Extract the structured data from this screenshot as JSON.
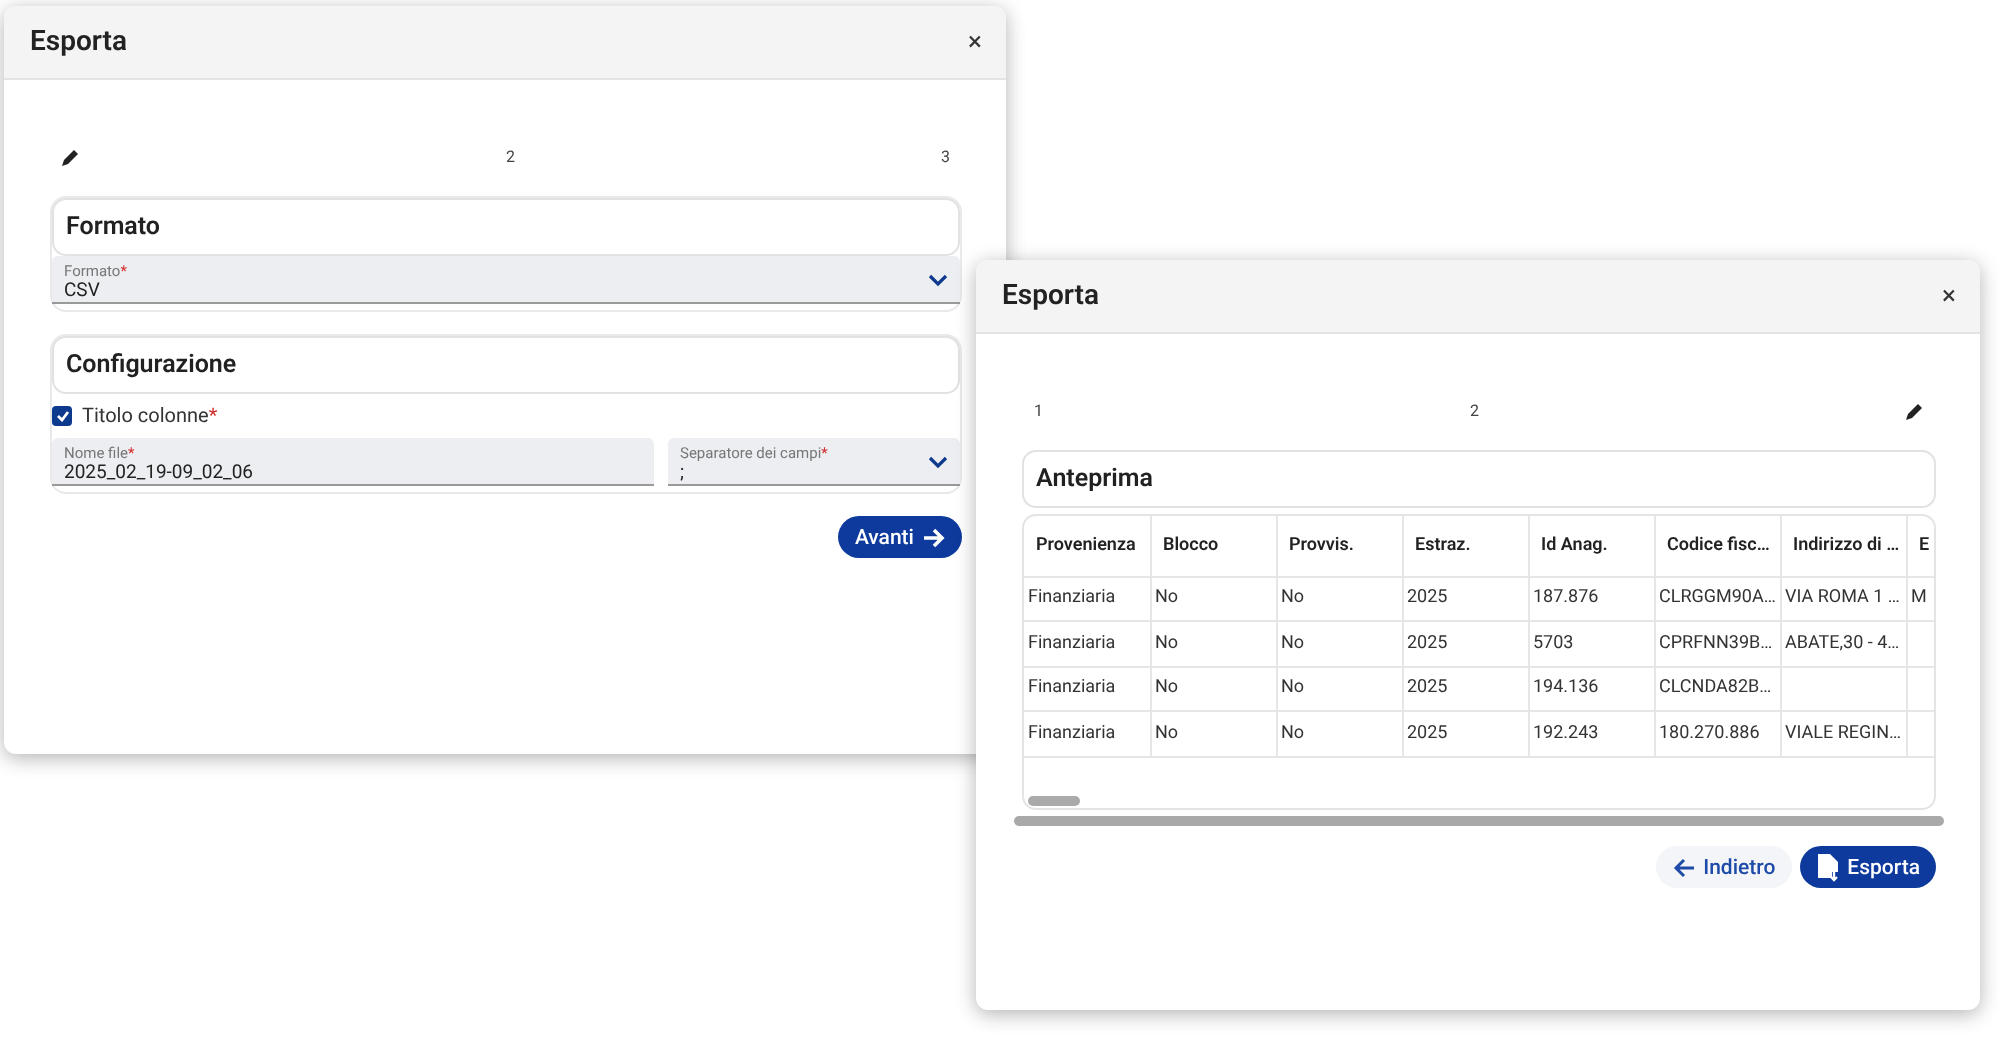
{
  "dialogs": [
    {
      "title": "Esporta",
      "close": "×",
      "steps": [
        {
          "kind": "edit"
        },
        {
          "kind": "number",
          "label": "2"
        },
        {
          "kind": "number",
          "label": "3"
        }
      ],
      "sections": [
        {
          "title": "Formato",
          "fields": [
            {
              "kind": "select",
              "label": "Formato",
              "required_mark": "*",
              "value": "CSV"
            }
          ]
        },
        {
          "title": "Configurazione",
          "checkbox": {
            "label": "Titolo colonne",
            "checked": true,
            "required_mark": "*"
          },
          "fields": [
            {
              "kind": "text",
              "label": "Nome file",
              "required_mark": "*",
              "value": "2025_02_19-09_02_06"
            },
            {
              "kind": "select",
              "label": "Separatore dei campi",
              "required_mark": "*",
              "value": ";"
            }
          ]
        }
      ],
      "buttons": [
        {
          "kind": "next",
          "label": "Avanti"
        }
      ]
    },
    {
      "title": "Esporta",
      "close": "×",
      "steps": [
        {
          "kind": "number",
          "label": "1"
        },
        {
          "kind": "number",
          "label": "2"
        },
        {
          "kind": "edit"
        }
      ],
      "preview": {
        "title": "Anteprima",
        "table": {
          "columns": [
            "Provenienza",
            "Blocco",
            "Provvis.",
            "Estraz.",
            "Id Anag.",
            "Codice fisc…",
            "Indirizzo di …",
            "E"
          ],
          "rows": [
            [
              "Finanziaria",
              "No",
              "No",
              "2025",
              "187.876",
              "CLRGGM90A…",
              "VIA ROMA 1 …",
              "M"
            ],
            [
              "Finanziaria",
              "No",
              "No",
              "2025",
              "5703",
              "CPRFNN39B…",
              "ABATE,30 - 4…",
              ""
            ],
            [
              "Finanziaria",
              "No",
              "No",
              "2025",
              "194.136",
              "CLCNDA82B…",
              "",
              ""
            ],
            [
              "Finanziaria",
              "No",
              "No",
              "2025",
              "192.243",
              "180.270.886",
              "VIALE REGIN…",
              ""
            ]
          ]
        }
      },
      "buttons": [
        {
          "kind": "back",
          "label": "Indietro"
        },
        {
          "kind": "export",
          "label": "Esporta"
        }
      ]
    }
  ]
}
